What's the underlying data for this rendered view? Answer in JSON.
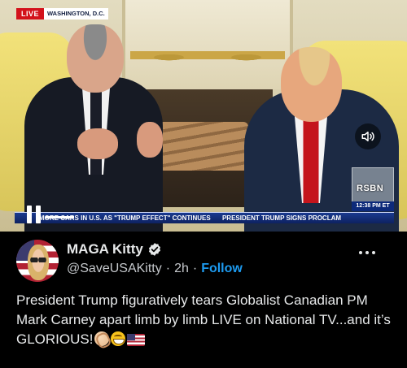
{
  "video": {
    "live_label": "LIVE",
    "location": "WASHINGTON, D.C.",
    "network_logo": "RSBN",
    "time": "12:38 PM ET",
    "ticker": [
      "MORE CARS IN U.S. AS \"TRUMP EFFECT\" CONTINUES",
      "PRESIDENT TRUMP SIGNS PROCLAM"
    ],
    "controls": {
      "pause_icon": "pause-icon",
      "volume_icon": "speaker-volume-icon",
      "progress": 0.08
    }
  },
  "tweet": {
    "display_name": "MAGA Kitty",
    "verified_icon": "verified-badge-icon",
    "verified_color": "#1d9bf0",
    "handle": "@SaveUSAKitty",
    "separator": "·",
    "time_ago": "2h",
    "follow_label": "Follow",
    "more_icon": "more-options-icon",
    "text": "President Trump figuratively tears Globalist Canadian PM Mark Carney apart limb by limb LIVE on National TV...and it’s GLORIOUS!",
    "emojis": [
      "clapping-hands-emoji",
      "grinning-squinting-face-emoji",
      "us-flag-emoji"
    ]
  },
  "colors": {
    "background": "#000000",
    "text": "#e7e9ea",
    "secondary_text": "#c5c8cc",
    "accent": "#1d9bf0",
    "live_red": "#d3121b",
    "ticker_blue": "#1a3a8f"
  }
}
